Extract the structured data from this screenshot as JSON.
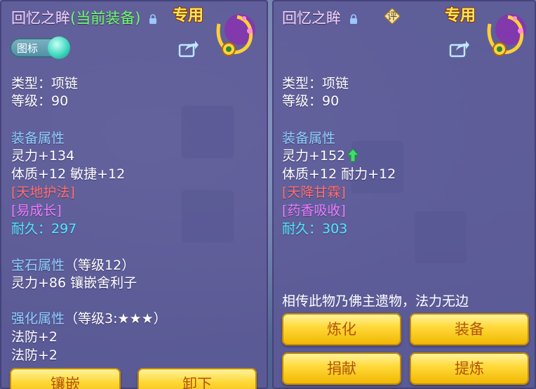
{
  "left_panel": {
    "title": "回忆之眸",
    "current_tag": "(当前装备)",
    "exclusive_badge": "专用",
    "toggle_label": "图标",
    "type_line": "类型：项链",
    "level_line": "等级：90",
    "attr_header": "装备属性",
    "attr_lines": [
      "灵力+134",
      "体质+12 敏捷+12"
    ],
    "special_1": "[天地护法]",
    "special_2": "[易成长]",
    "durability": "耐久：297",
    "gem_header": "宝石属性",
    "gem_level": "（等级12）",
    "gem_line": "灵力+86 镶嵌舍利子",
    "enhance_header": "强化属性",
    "enhance_level": "（等级3:★★★）",
    "enhance_lines": [
      "法防+2",
      "法防+2"
    ],
    "buttons": [
      "镶嵌",
      "卸下"
    ]
  },
  "right_panel": {
    "title": "回忆之眸",
    "rate_badge": "评",
    "exclusive_badge": "专用",
    "type_line": "类型：项链",
    "level_line": "等级：90",
    "attr_header": "装备属性",
    "attr_lines": [
      "灵力+152",
      "体质+12 耐力+12"
    ],
    "special_1": "[天降甘霖]",
    "special_2": "[药香吸收]",
    "durability": "耐久：303",
    "description": "相传此物乃佛主遗物，法力无边",
    "buttons": [
      "炼化",
      "装备",
      "捐献",
      "提炼"
    ]
  },
  "colors": {
    "panel_bg": "#5c5896",
    "header_blue": "#8fd0ff",
    "special_red": "#ff7070",
    "special_purple": "#ec7cff",
    "durability_cyan": "#52e9ff",
    "current_green": "#6dff6d",
    "button_gold": "#ffd836"
  },
  "icons": [
    "lock-icon",
    "share-icon",
    "necklace-icon",
    "rating-icon",
    "up-arrow-icon"
  ]
}
